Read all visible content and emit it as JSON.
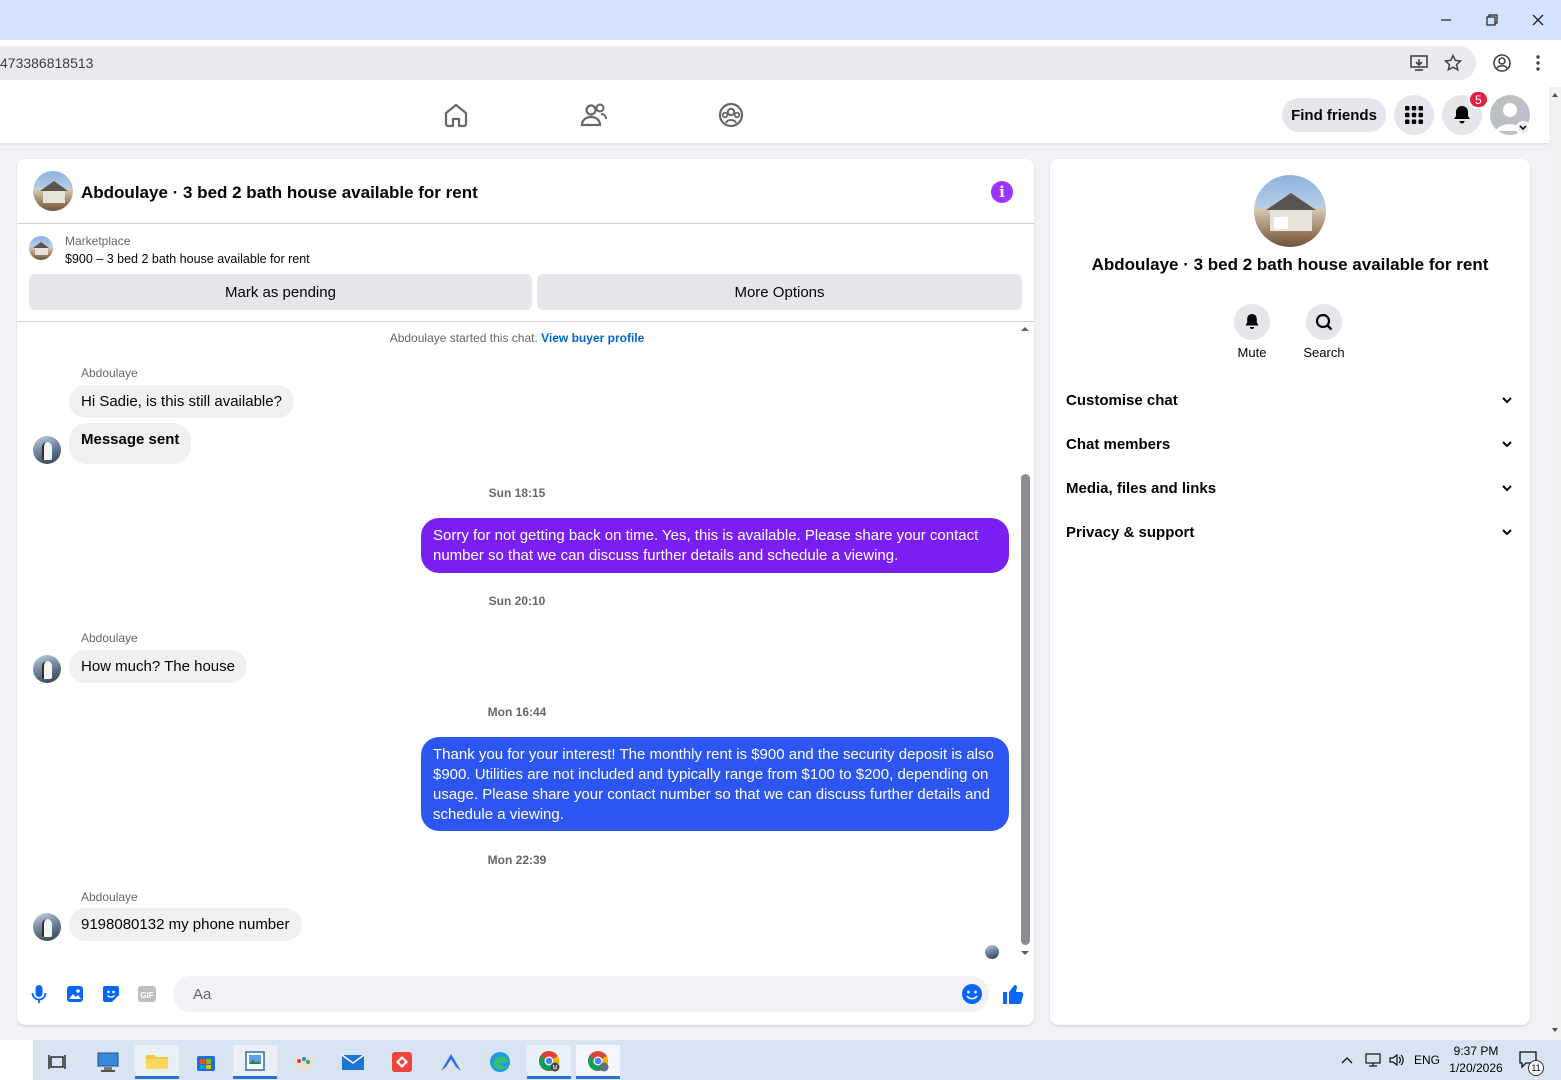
{
  "browser": {
    "url": "473386818513"
  },
  "nav": {
    "find_friends": "Find friends",
    "notification_count": "5"
  },
  "chat": {
    "title": "Abdoulaye · 3 bed 2 bath house available for rent",
    "marketplace_label": "Marketplace",
    "listing": "$900 – 3 bed 2 bath house available for rent",
    "mark_pending": "Mark as pending",
    "more_options": "More Options",
    "started_text": "Abdoulaye started this chat.",
    "view_buyer_profile": "View buyer profile",
    "messages": [
      {
        "type": "sender",
        "text": "Abdoulaye"
      },
      {
        "type": "in",
        "text": "Hi Sadie, is this still available?"
      },
      {
        "type": "in_bold",
        "text": "Message sent"
      },
      {
        "type": "time",
        "text": "Sun 18:15"
      },
      {
        "type": "out",
        "lines": [
          "Sorry for not getting back on time. Yes, this is available. Please share your contact",
          "number so that we can discuss further details and schedule a viewing."
        ]
      },
      {
        "type": "time",
        "text": "Sun 20:10"
      },
      {
        "type": "sender",
        "text": "Abdoulaye"
      },
      {
        "type": "in",
        "text": "How much? The house"
      },
      {
        "type": "time",
        "text": "Mon 16:44"
      },
      {
        "type": "out",
        "lines": [
          "Thank you for your interest! The monthly rent is $900 and the security deposit is also",
          "$900. Utilities are not included and typically range from $100 to $200, depending on",
          "usage. Please share your contact number so that we can discuss further details and",
          "schedule a viewing."
        ]
      },
      {
        "type": "time",
        "text": "Mon 22:39"
      },
      {
        "type": "sender",
        "text": "Abdoulaye"
      },
      {
        "type": "in",
        "text": "9198080132 my phone number"
      }
    ],
    "composer_placeholder": "Aa"
  },
  "info": {
    "title": "Abdoulaye · 3 bed 2 bath house available for rent",
    "mute": "Mute",
    "search": "Search",
    "rows": [
      "Customise chat",
      "Chat members",
      "Media, files and links",
      "Privacy & support"
    ]
  },
  "taskbar": {
    "lang": "ENG",
    "time": "9:37 PM",
    "date": "1/20/2026",
    "notif_count": "11"
  },
  "colors": {
    "bubble_purple": "#7a1ff2",
    "bubble_blue": "#2c55f2",
    "accent": "#0866ff"
  }
}
